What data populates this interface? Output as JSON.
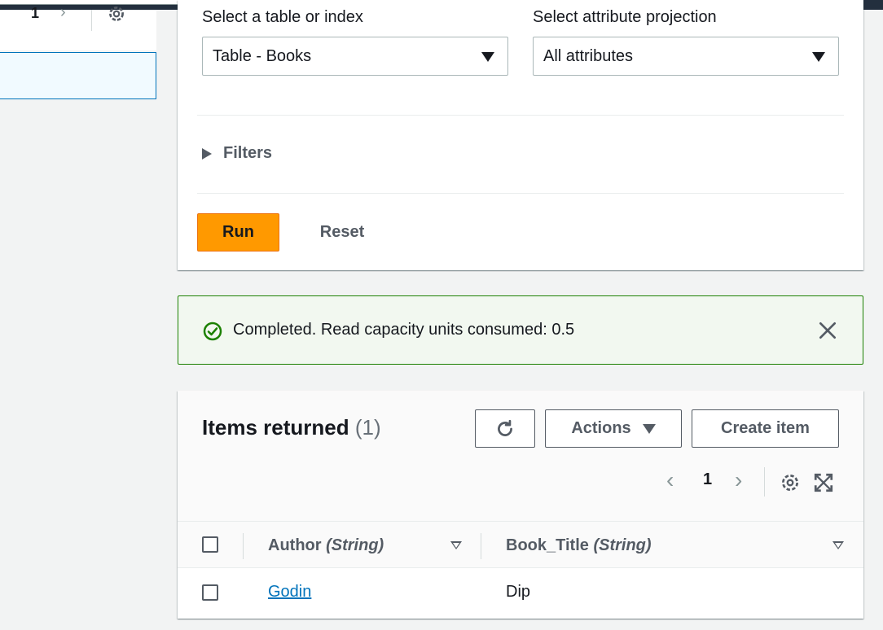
{
  "left_panel": {
    "page_number": "1"
  },
  "query": {
    "table_label": "Select a table or index",
    "table_value": "Table - Books",
    "projection_label": "Select attribute projection",
    "projection_value": "All attributes",
    "filters_label": "Filters",
    "run_label": "Run",
    "reset_label": "Reset"
  },
  "flash": {
    "message": "Completed. Read capacity units consumed: 0.5",
    "status_color": "#1d8102"
  },
  "results": {
    "title": "Items returned",
    "count": "(1)",
    "actions_label": "Actions",
    "create_label": "Create item",
    "page_number": "1",
    "columns": [
      {
        "name": "Author",
        "type": "(String)"
      },
      {
        "name": "Book_Title",
        "type": "(String)"
      }
    ],
    "rows": [
      {
        "author": "Godin",
        "book_title": "Dip"
      }
    ]
  },
  "colors": {
    "primary_button": "#ff9900",
    "link": "#0073bb",
    "topbar": "#232f3e"
  },
  "icons": [
    "refresh-icon",
    "settings-gear-icon",
    "fullscreen-icon",
    "success-check-icon",
    "close-icon",
    "chevron-left-icon",
    "chevron-right-icon",
    "caret-down-icon"
  ]
}
